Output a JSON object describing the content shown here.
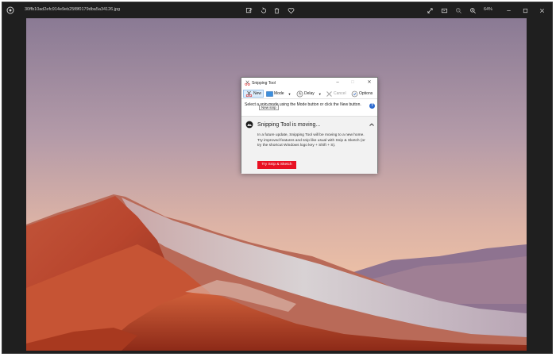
{
  "viewer": {
    "filename": "30ffb10ad2efc914e9eb25f8f0179dba5a34126.jpg",
    "zoom_label": "64%",
    "toolbar_icons": [
      "edit-icon",
      "rotate-icon",
      "delete-icon",
      "favorite-icon"
    ],
    "right_icons": [
      "fullscreen-icon",
      "slideshow-icon",
      "zoom-out-icon",
      "zoom-in-icon"
    ],
    "window_controls": [
      "minimize-icon",
      "maximize-icon",
      "close-icon"
    ]
  },
  "snipping_tool": {
    "title": "Snipping Tool",
    "toolbar": {
      "new": "New",
      "mode": "Mode",
      "delay": "Delay",
      "cancel": "Cancel",
      "options": "Options"
    },
    "help_text": "Select a snip mode using the Mode button or click the New button.",
    "tooltip": "New snip",
    "help_icon": "?",
    "notice": {
      "title": "Snipping Tool is moving...",
      "body": "In a future update, Snipping Tool will be moving to a new home. Try improved features and snip like usual with Snip & Sketch (or try the shortcut Windows logo key + Shift + S).",
      "button": "Try Snip & Sketch"
    }
  },
  "colors": {
    "viewer_bg": "#1f1f1f",
    "accent_red": "#e81123",
    "sky_top": "#8d7b95",
    "sky_bottom": "#e7b6a0"
  }
}
